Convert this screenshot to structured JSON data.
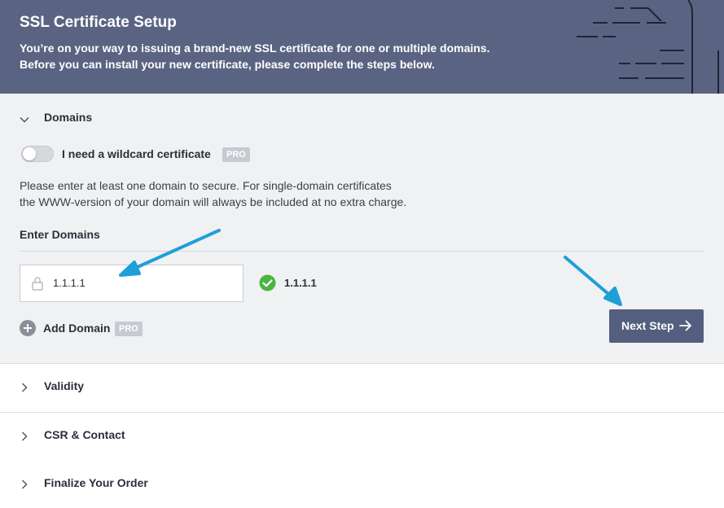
{
  "header": {
    "title": "SSL Certificate Setup",
    "subtitle_line1": "You’re on your way to issuing a brand-new SSL certificate for one or multiple domains.",
    "subtitle_line2": "Before you can install your new certificate, please complete the steps below."
  },
  "domains_section": {
    "title": "Domains",
    "wildcard_label": "I need a wildcard certificate",
    "wildcard_enabled": false,
    "pro_badge": "PRO",
    "description_line1": "Please enter at least one domain to secure. For single-domain certificates",
    "description_line2": "the WWW-version of your domain will always be included at no extra charge.",
    "enter_label": "Enter Domains",
    "domain_input_value": "1.1.1.1",
    "validated_domain": "1.1.1.1",
    "add_domain_label": "Add Domain",
    "add_domain_badge": "PRO",
    "next_button_label": "Next Step"
  },
  "collapsed_sections": [
    {
      "title": "Validity"
    },
    {
      "title": "CSR & Contact"
    },
    {
      "title": "Finalize Your Order"
    }
  ],
  "colors": {
    "header_bg": "#5a6482",
    "section_bg": "#f0f1f3",
    "button_bg": "#545e7e",
    "success": "#4bb543",
    "annotation_arrow": "#1e9fd8",
    "pro_badge_bg": "#c7cad1"
  },
  "icons": [
    "chevron-down-icon",
    "chevron-right-icon",
    "lock-icon",
    "check-circle-icon",
    "plus-circle-icon",
    "arrow-right-icon"
  ]
}
